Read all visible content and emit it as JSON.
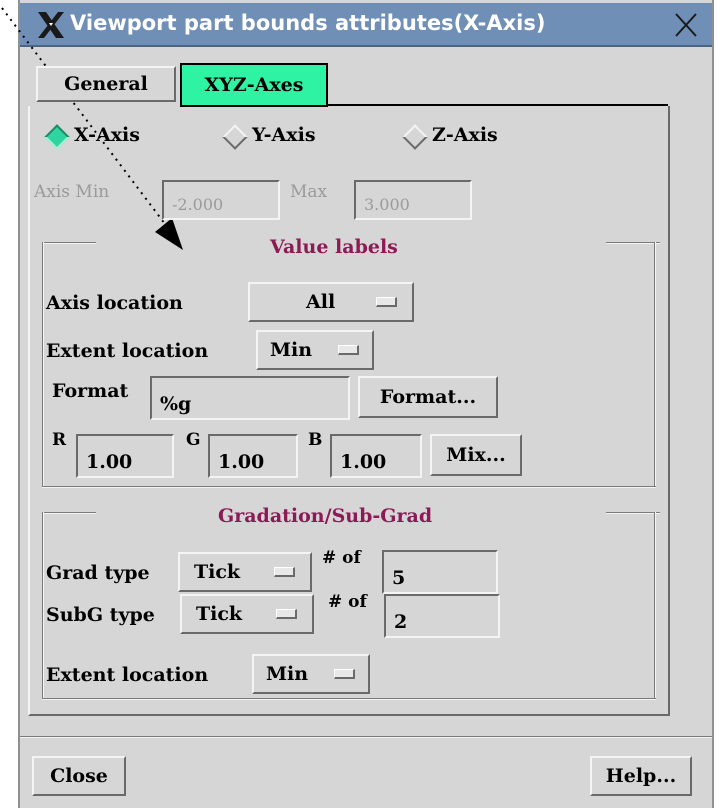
{
  "window": {
    "title": "Viewport part bounds attributes(X-Axis)",
    "sysmenu_icon": "x-logo-icon",
    "close_icon": "close-icon"
  },
  "tabs": [
    {
      "label": "General",
      "active": false
    },
    {
      "label": "XYZ-Axes",
      "active": true,
      "color": "#2ef3a2"
    }
  ],
  "axis_select": {
    "options": [
      "X-Axis",
      "Y-Axis",
      "Z-Axis"
    ],
    "selected": "X-Axis",
    "selected_color": "#2fd4a0"
  },
  "axis_range": {
    "min_label": "Axis Min",
    "min_value": "-2.000",
    "max_label": "Max",
    "max_value": "3.000"
  },
  "value_labels": {
    "title": "Value labels",
    "title_color": "#8b1a55",
    "axis_location_label": "Axis location",
    "axis_location_value": "All",
    "extent_location_label": "Extent location",
    "extent_location_value": "Min",
    "format_label": "Format",
    "format_value": "%g",
    "format_button": "Format...",
    "r_label": "R",
    "r_value": "1.00",
    "g_label": "G",
    "g_value": "1.00",
    "b_label": "B",
    "b_value": "1.00",
    "mix_button": "Mix..."
  },
  "gradation": {
    "title": "Gradation/Sub-Grad",
    "grad_type_label": "Grad type",
    "grad_type_value": "Tick",
    "grad_count_label": "# of",
    "grad_count_value": "5",
    "subg_type_label": "SubG type",
    "subg_type_value": "Tick",
    "subg_count_label": "# of",
    "subg_count_value": "2",
    "extent_location_label": "Extent location",
    "extent_location_value": "Min"
  },
  "footer": {
    "close_button": "Close",
    "help_button": "Help..."
  }
}
